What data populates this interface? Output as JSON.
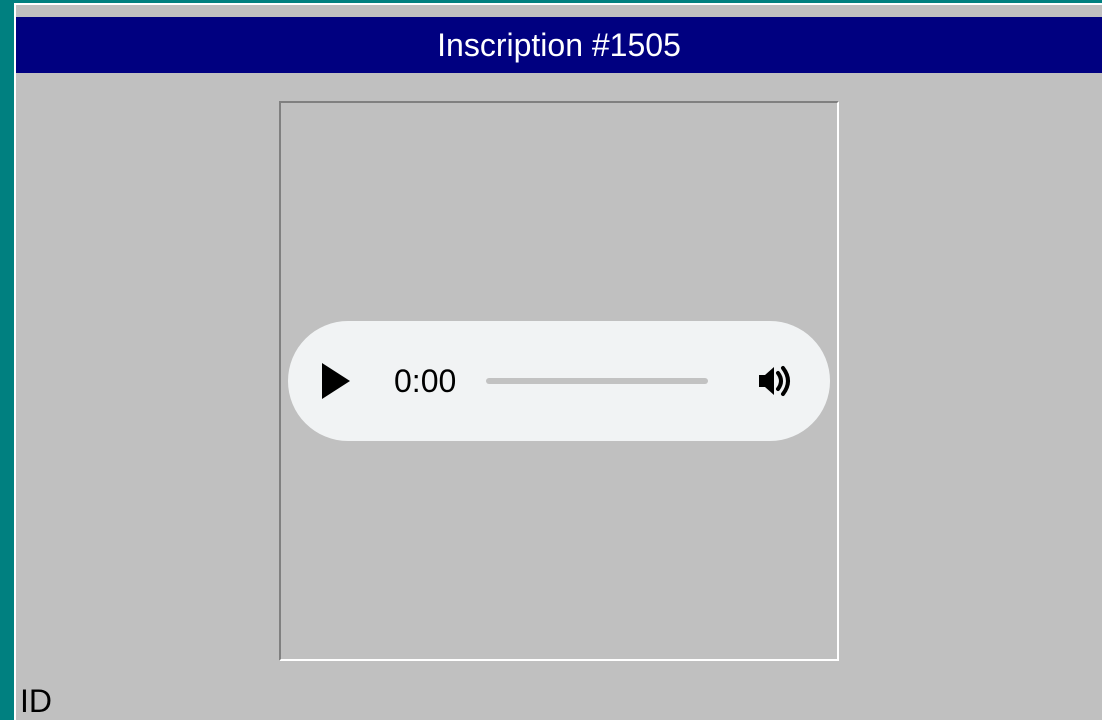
{
  "header": {
    "title": "Inscription #1505"
  },
  "player": {
    "current_time": "0:00"
  },
  "labels": {
    "id": "ID"
  }
}
